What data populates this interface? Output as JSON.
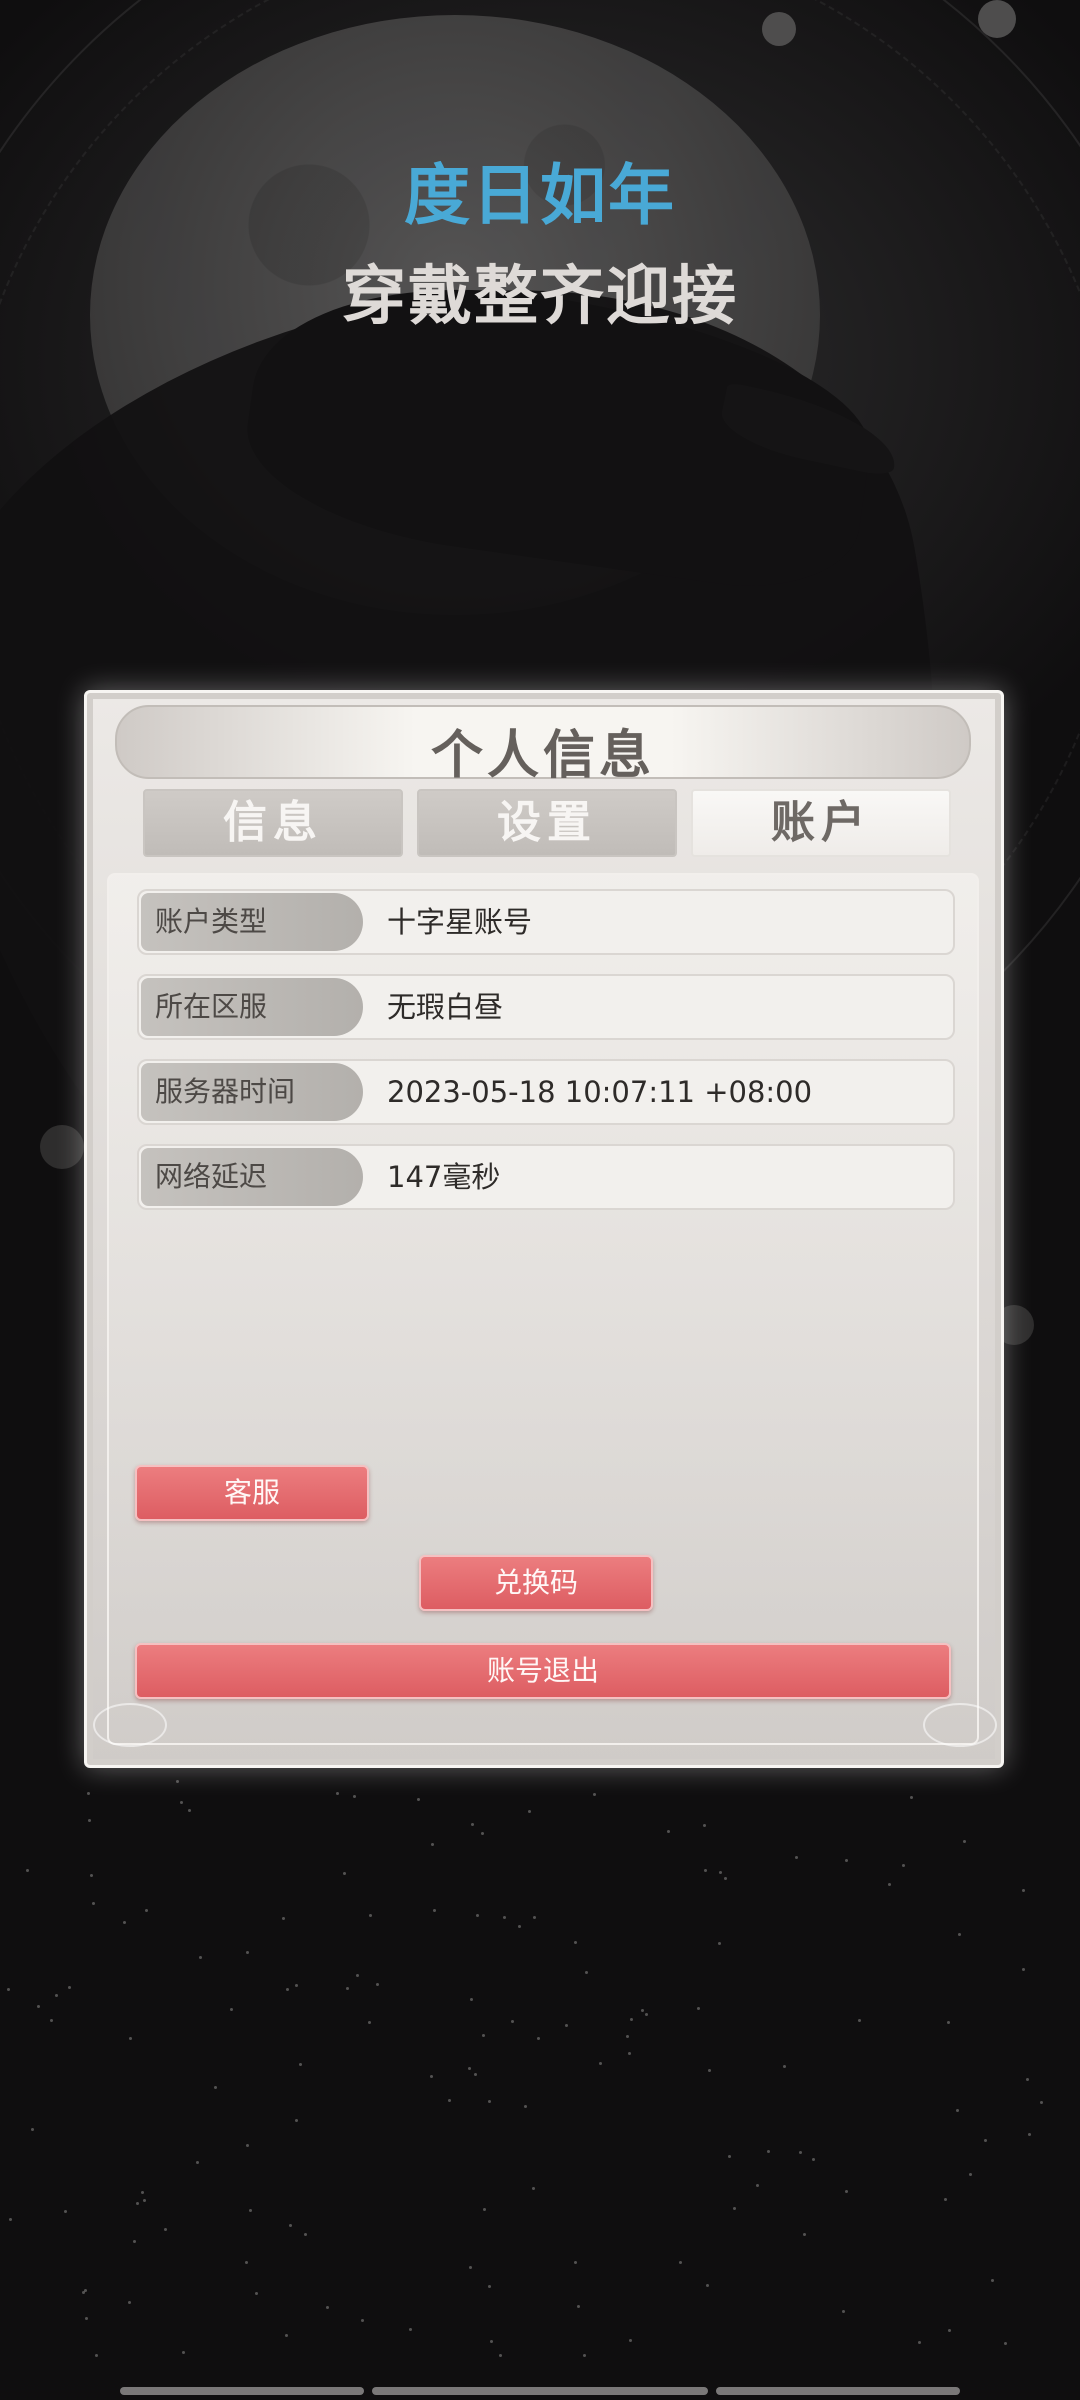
{
  "banner": {
    "headline": "度日如年",
    "subheadline": "穿戴整齐迎接"
  },
  "panel": {
    "title": "个人信息",
    "tabs": [
      {
        "label": "信息",
        "active": false
      },
      {
        "label": "设置",
        "active": false
      },
      {
        "label": "账户",
        "active": true
      }
    ],
    "rows": [
      {
        "label": "账户类型",
        "value": "十字星账号"
      },
      {
        "label": "所在区服",
        "value": "无瑕白昼"
      },
      {
        "label": "服务器时间",
        "value": "2023-05-18 10:07:11 +08:00"
      },
      {
        "label": "网络延迟",
        "value": "147毫秒"
      }
    ],
    "buttons": {
      "customer_service": "客服",
      "redeem_code": "兑换码",
      "logout": "账号退出"
    }
  },
  "colors": {
    "headline": "#49a9d6",
    "subheadline": "#dedad7",
    "button": "#e2666a",
    "background": "#0e0d0e"
  }
}
